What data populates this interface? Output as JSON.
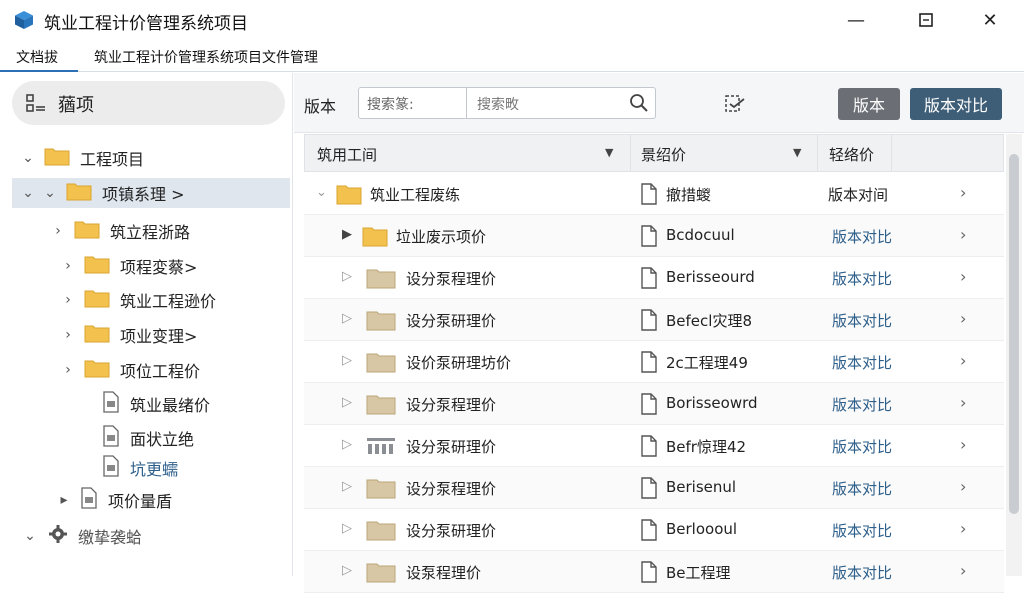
{
  "window": {
    "title": "筑业工程计价管理系统项目",
    "minimize": "—",
    "maximize": "▢",
    "close": "✕"
  },
  "menubar": {
    "items": [
      "文档拔",
      "筑业工程计价管理系统项目文件管理"
    ]
  },
  "sidebar": {
    "header": "蕕项",
    "tree": [
      {
        "label": "工程项目",
        "level": 0,
        "expanded": true,
        "icon": "folder-icon"
      },
      {
        "label": "项镇系理 >",
        "level": 1,
        "expanded": true,
        "icon": "folder-icon",
        "selected": true
      },
      {
        "label": "筑立程浙路",
        "level": 2,
        "expanded": false,
        "icon": "folder-icon"
      },
      {
        "label": "项程変蔡>",
        "level": 2,
        "expanded": false,
        "icon": "folder-icon"
      },
      {
        "label": "筑业工程逊价",
        "level": 2,
        "expanded": false,
        "icon": "folder-icon"
      },
      {
        "label": "项业变理>",
        "level": 2,
        "expanded": false,
        "icon": "folder-icon"
      },
      {
        "label": "项位工程价",
        "level": 2,
        "expanded": false,
        "icon": "folder-icon"
      },
      {
        "label": "筑业最绪价",
        "level": 3,
        "icon": "document-icon"
      },
      {
        "label": "面状立绝",
        "level": 3,
        "icon": "document-icon"
      },
      {
        "label": "坑更蠕",
        "level": 3,
        "icon": "document-icon",
        "highlight": true
      },
      {
        "label": "项价量盾",
        "level": 3,
        "icon": "document-icon"
      }
    ],
    "footer": "缴挚袭蛤"
  },
  "toolbar": {
    "label": "版本",
    "search_field": "搜索篆:",
    "search_placeholder": "搜索畋",
    "version_button": "版本",
    "compare_button": "版本对比"
  },
  "table": {
    "columns": [
      "筑用工间",
      "景绍价",
      "轻络价"
    ],
    "rows": [
      {
        "name": "筑业工程废练",
        "file": "撤措蝬",
        "action": "版本对间",
        "level": 0,
        "expand": "⌄",
        "action_style": "plain"
      },
      {
        "name": "垃业废示项价",
        "file": "Bcdocuul",
        "action": "版本对比",
        "level": 1,
        "expand": "▶",
        "action_style": "link"
      },
      {
        "name": "设分泵程理价",
        "file": "Berisseourd",
        "action": "版本对比",
        "level": 2,
        "expand": "▷",
        "action_style": "link"
      },
      {
        "name": "设分泵研理价",
        "file": "Befecl灾理8",
        "action": "版本对比",
        "level": 2,
        "expand": "▷",
        "action_style": "link"
      },
      {
        "name": "设价泵研理坊价",
        "file": "2c工程理49",
        "action": "版本对比",
        "level": 2,
        "expand": "▷",
        "action_style": "link"
      },
      {
        "name": "设分泵程理价",
        "file": "Borisseowrd",
        "action": "版本对比",
        "level": 2,
        "expand": "▷",
        "action_style": "link"
      },
      {
        "name": "设分泵研理价",
        "file": "Befr惊理42",
        "action": "版本对比",
        "level": 2,
        "expand": "▷",
        "action_style": "link"
      },
      {
        "name": "设分泵程理价",
        "file": "Berisenul",
        "action": "版本对比",
        "level": 2,
        "expand": "▷",
        "action_style": "link"
      },
      {
        "name": "设分泵研理价",
        "file": "Berloooul",
        "action": "版本对比",
        "level": 2,
        "expand": "▷",
        "action_style": "link"
      },
      {
        "name": "设泵程理价",
        "file": "Be工程理",
        "action": "版本对比",
        "level": 2,
        "expand": "▷",
        "action_style": "link"
      }
    ]
  },
  "colors": {
    "accent": "#2c6fb5",
    "button_dark": "#3e5e77",
    "button_grey": "#6b6f75",
    "folder": "#f2c14e",
    "link": "#2d5f8b"
  }
}
